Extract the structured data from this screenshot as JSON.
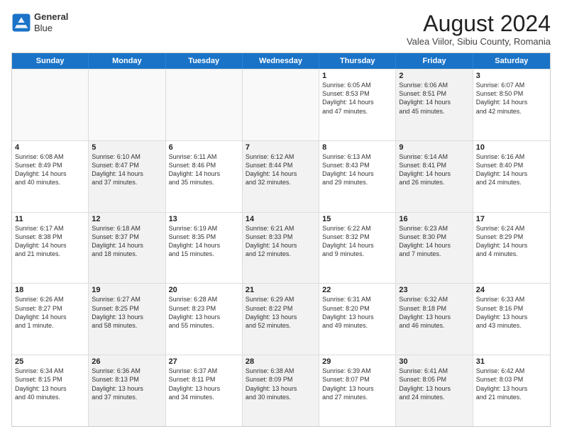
{
  "header": {
    "logo_line1": "General",
    "logo_line2": "Blue",
    "month_year": "August 2024",
    "location": "Valea Viilor, Sibiu County, Romania"
  },
  "day_headers": [
    "Sunday",
    "Monday",
    "Tuesday",
    "Wednesday",
    "Thursday",
    "Friday",
    "Saturday"
  ],
  "weeks": [
    [
      {
        "num": "",
        "info": "",
        "empty": true
      },
      {
        "num": "",
        "info": "",
        "empty": true
      },
      {
        "num": "",
        "info": "",
        "empty": true
      },
      {
        "num": "",
        "info": "",
        "empty": true
      },
      {
        "num": "1",
        "info": "Sunrise: 6:05 AM\nSunset: 8:53 PM\nDaylight: 14 hours\nand 47 minutes.",
        "shaded": false
      },
      {
        "num": "2",
        "info": "Sunrise: 6:06 AM\nSunset: 8:51 PM\nDaylight: 14 hours\nand 45 minutes.",
        "shaded": true
      },
      {
        "num": "3",
        "info": "Sunrise: 6:07 AM\nSunset: 8:50 PM\nDaylight: 14 hours\nand 42 minutes.",
        "shaded": false
      }
    ],
    [
      {
        "num": "4",
        "info": "Sunrise: 6:08 AM\nSunset: 8:49 PM\nDaylight: 14 hours\nand 40 minutes.",
        "shaded": false
      },
      {
        "num": "5",
        "info": "Sunrise: 6:10 AM\nSunset: 8:47 PM\nDaylight: 14 hours\nand 37 minutes.",
        "shaded": true
      },
      {
        "num": "6",
        "info": "Sunrise: 6:11 AM\nSunset: 8:46 PM\nDaylight: 14 hours\nand 35 minutes.",
        "shaded": false
      },
      {
        "num": "7",
        "info": "Sunrise: 6:12 AM\nSunset: 8:44 PM\nDaylight: 14 hours\nand 32 minutes.",
        "shaded": true
      },
      {
        "num": "8",
        "info": "Sunrise: 6:13 AM\nSunset: 8:43 PM\nDaylight: 14 hours\nand 29 minutes.",
        "shaded": false
      },
      {
        "num": "9",
        "info": "Sunrise: 6:14 AM\nSunset: 8:41 PM\nDaylight: 14 hours\nand 26 minutes.",
        "shaded": true
      },
      {
        "num": "10",
        "info": "Sunrise: 6:16 AM\nSunset: 8:40 PM\nDaylight: 14 hours\nand 24 minutes.",
        "shaded": false
      }
    ],
    [
      {
        "num": "11",
        "info": "Sunrise: 6:17 AM\nSunset: 8:38 PM\nDaylight: 14 hours\nand 21 minutes.",
        "shaded": false
      },
      {
        "num": "12",
        "info": "Sunrise: 6:18 AM\nSunset: 8:37 PM\nDaylight: 14 hours\nand 18 minutes.",
        "shaded": true
      },
      {
        "num": "13",
        "info": "Sunrise: 6:19 AM\nSunset: 8:35 PM\nDaylight: 14 hours\nand 15 minutes.",
        "shaded": false
      },
      {
        "num": "14",
        "info": "Sunrise: 6:21 AM\nSunset: 8:33 PM\nDaylight: 14 hours\nand 12 minutes.",
        "shaded": true
      },
      {
        "num": "15",
        "info": "Sunrise: 6:22 AM\nSunset: 8:32 PM\nDaylight: 14 hours\nand 9 minutes.",
        "shaded": false
      },
      {
        "num": "16",
        "info": "Sunrise: 6:23 AM\nSunset: 8:30 PM\nDaylight: 14 hours\nand 7 minutes.",
        "shaded": true
      },
      {
        "num": "17",
        "info": "Sunrise: 6:24 AM\nSunset: 8:29 PM\nDaylight: 14 hours\nand 4 minutes.",
        "shaded": false
      }
    ],
    [
      {
        "num": "18",
        "info": "Sunrise: 6:26 AM\nSunset: 8:27 PM\nDaylight: 14 hours\nand 1 minute.",
        "shaded": false
      },
      {
        "num": "19",
        "info": "Sunrise: 6:27 AM\nSunset: 8:25 PM\nDaylight: 13 hours\nand 58 minutes.",
        "shaded": true
      },
      {
        "num": "20",
        "info": "Sunrise: 6:28 AM\nSunset: 8:23 PM\nDaylight: 13 hours\nand 55 minutes.",
        "shaded": false
      },
      {
        "num": "21",
        "info": "Sunrise: 6:29 AM\nSunset: 8:22 PM\nDaylight: 13 hours\nand 52 minutes.",
        "shaded": true
      },
      {
        "num": "22",
        "info": "Sunrise: 6:31 AM\nSunset: 8:20 PM\nDaylight: 13 hours\nand 49 minutes.",
        "shaded": false
      },
      {
        "num": "23",
        "info": "Sunrise: 6:32 AM\nSunset: 8:18 PM\nDaylight: 13 hours\nand 46 minutes.",
        "shaded": true
      },
      {
        "num": "24",
        "info": "Sunrise: 6:33 AM\nSunset: 8:16 PM\nDaylight: 13 hours\nand 43 minutes.",
        "shaded": false
      }
    ],
    [
      {
        "num": "25",
        "info": "Sunrise: 6:34 AM\nSunset: 8:15 PM\nDaylight: 13 hours\nand 40 minutes.",
        "shaded": false
      },
      {
        "num": "26",
        "info": "Sunrise: 6:36 AM\nSunset: 8:13 PM\nDaylight: 13 hours\nand 37 minutes.",
        "shaded": true
      },
      {
        "num": "27",
        "info": "Sunrise: 6:37 AM\nSunset: 8:11 PM\nDaylight: 13 hours\nand 34 minutes.",
        "shaded": false
      },
      {
        "num": "28",
        "info": "Sunrise: 6:38 AM\nSunset: 8:09 PM\nDaylight: 13 hours\nand 30 minutes.",
        "shaded": true
      },
      {
        "num": "29",
        "info": "Sunrise: 6:39 AM\nSunset: 8:07 PM\nDaylight: 13 hours\nand 27 minutes.",
        "shaded": false
      },
      {
        "num": "30",
        "info": "Sunrise: 6:41 AM\nSunset: 8:05 PM\nDaylight: 13 hours\nand 24 minutes.",
        "shaded": true
      },
      {
        "num": "31",
        "info": "Sunrise: 6:42 AM\nSunset: 8:03 PM\nDaylight: 13 hours\nand 21 minutes.",
        "shaded": false
      }
    ]
  ]
}
